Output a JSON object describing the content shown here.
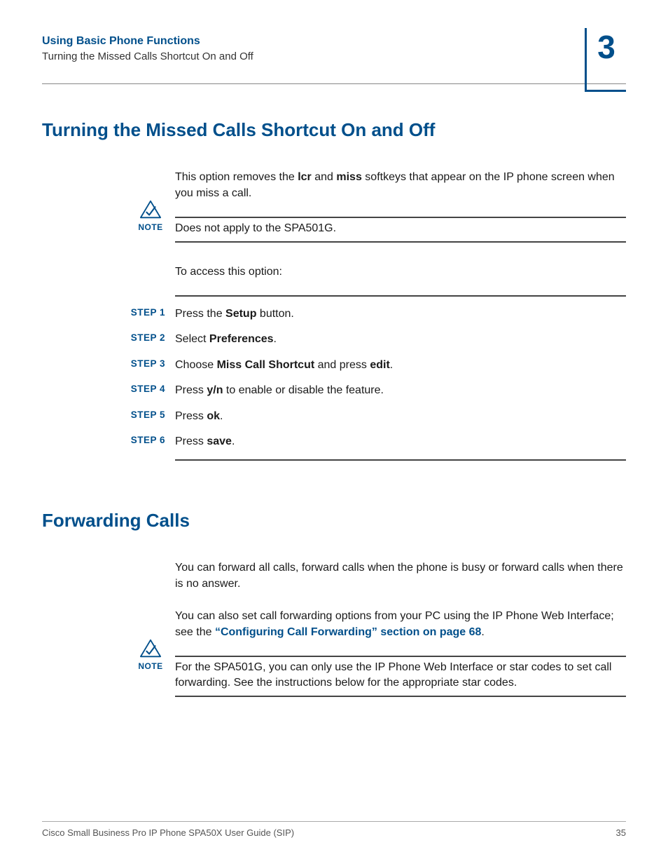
{
  "header": {
    "title": "Using Basic Phone Functions",
    "subtitle": "Turning the Missed Calls Shortcut On and Off",
    "chapter": "3"
  },
  "section1": {
    "heading": "Turning the Missed Calls Shortcut On and Off",
    "p1_prefix": "This option removes the ",
    "p1_b1": "lcr",
    "p1_mid": " and ",
    "p1_b2": "miss",
    "p1_suffix": " softkeys that appear on the IP phone screen when you miss a call.",
    "note_label": "NOTE",
    "note_text": "Does not apply to the SPA501G.",
    "access_intro": "To access this option:"
  },
  "steps": [
    {
      "label": "STEP  1",
      "prefix": "Press the ",
      "b1": "Setup",
      "mid": " button.",
      "b2": "",
      "suffix": ""
    },
    {
      "label": "STEP  2",
      "prefix": "Select ",
      "b1": "Preferences",
      "mid": ".",
      "b2": "",
      "suffix": ""
    },
    {
      "label": "STEP  3",
      "prefix": "Choose ",
      "b1": "Miss Call Shortcut",
      "mid": " and press ",
      "b2": "edit",
      "suffix": "."
    },
    {
      "label": "STEP  4",
      "prefix": "Press ",
      "b1": "y/n",
      "mid": " to enable or disable the feature.",
      "b2": "",
      "suffix": ""
    },
    {
      "label": "STEP  5",
      "prefix": "Press ",
      "b1": "ok",
      "mid": ".",
      "b2": "",
      "suffix": ""
    },
    {
      "label": "STEP  6",
      "prefix": "Press ",
      "b1": "save",
      "mid": ".",
      "b2": "",
      "suffix": ""
    }
  ],
  "section2": {
    "heading": "Forwarding Calls",
    "p1": "You can forward all calls, forward calls when the phone is busy or forward calls when there is no answer.",
    "p2_prefix": "You can also set call forwarding options from your PC using the IP Phone Web Interface; see the ",
    "p2_link": "“Configuring Call Forwarding” section on page 68",
    "p2_suffix": ".",
    "note_label": "NOTE",
    "note_text": "For the SPA501G, you can only use the IP Phone Web Interface or star codes to set call forwarding. See the instructions below for the appropriate star codes."
  },
  "footer": {
    "doc_title": "Cisco Small Business Pro IP Phone SPA50X User Guide (SIP)",
    "page_num": "35"
  }
}
